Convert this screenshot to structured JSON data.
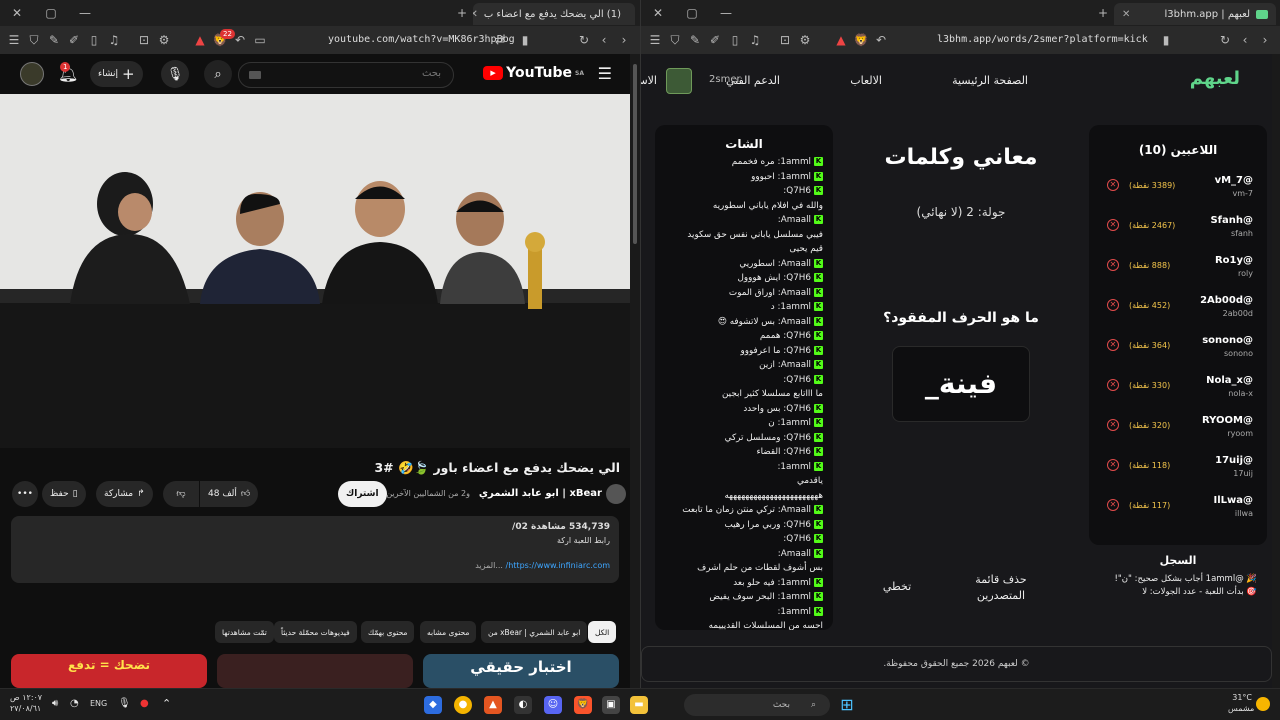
{
  "left": {
    "tab_title": "(1) الي يضحك يدفع مع اعضاء ب",
    "url": "youtube.com/watch?v=MK86r3hpBbg",
    "brave_count": "22",
    "yt": {
      "logo": "YouTube",
      "region": "SA",
      "search_placeholder": "بحث",
      "create_label": "إنشاء",
      "notif_count": "1"
    },
    "video_title": "الي يضحك يدفع مع اعضاء باور 🍃🤣 #3",
    "channel": "xBear | ابو عابد الشمري",
    "collab": "و2 من الشماليين الآخرين",
    "subscribe": "اشتراك",
    "likes": "48 ألف",
    "share": "مشاركة",
    "save": "حفظ",
    "views": "534,739 مشاهدة 02/",
    "desc_line": "رابط اللعبة اركة",
    "desc_link": "https://www.infiniarc.com/",
    "more": "...المزيد",
    "chips": [
      "الكل",
      "من xBear | ابو عابد الشمري",
      "محتوى مشابه",
      "محتوى بهمّك",
      "فيديوهات محمّلة حديثاً",
      "تمّت مشاهدتها"
    ],
    "thumb_texts": [
      "تضحك = تدفع",
      "",
      "اختبار حقيقي"
    ]
  },
  "right": {
    "tab_title": "لعبهم | l3bhm.app",
    "url": "l3bhm.app/words/2smer?platform=kick",
    "logo": "لعبهم",
    "nav": [
      "الصفحة الرئيسية",
      "الالعاب",
      "الدعم الفني"
    ],
    "nav_user": "2smer",
    "nav_partial": "الاس",
    "players_title": "اللاعبين (10)",
    "players": [
      {
        "name": "@vM_7",
        "id": "vm-7",
        "points": "(3389 نقطة)"
      },
      {
        "name": "@Sfanh",
        "id": "sfanh",
        "points": "(2467 نقطة)"
      },
      {
        "name": "@Ro1y",
        "id": "roly",
        "points": "(888 نقطة)"
      },
      {
        "name": "@2Ab00d",
        "id": "2ab00d",
        "points": "(452 نقطة)"
      },
      {
        "name": "@sonono",
        "id": "sonono",
        "points": "(364 نقطة)"
      },
      {
        "name": "@Nola_x",
        "id": "nola-x",
        "points": "(330 نقطة)"
      },
      {
        "name": "@RYOOM",
        "id": "ryoom",
        "points": "(320 نقطة)"
      },
      {
        "name": "@17uij",
        "id": "17uij",
        "points": "(118 نقطة)"
      },
      {
        "name": "@IlLwa",
        "id": "illwa",
        "points": "(117 نقطة)"
      }
    ],
    "log_title": "السجل",
    "log": [
      "🎉 @1amml أجاب بشكل صحيح: \"ن\"!",
      "🎯 بدأت اللعبة - عدد الجولات: لا"
    ],
    "game_title": "معاني وكلمات",
    "round": "جولة: 2 (لا نهائي)",
    "question": "ما هو الحرف المفقود؟",
    "word": "فينة_",
    "btn_clear": "حذف قائمة المتصدرين",
    "btn_skip": "تخطي",
    "chat_title": "الشات",
    "chat": [
      {
        "u": "1amml:",
        "m": "مره فخممم",
        "k": true
      },
      {
        "u": "1amml:",
        "m": "احبووو",
        "k": true
      },
      {
        "u": "Q7H6:",
        "m": "",
        "k": true
      },
      {
        "u": "",
        "m": "والله في افلام ياباني اسطوريه",
        "k": false
      },
      {
        "u": "Amaall:",
        "m": "",
        "k": true
      },
      {
        "u": "",
        "m": "فيبي مسلسل ياباني نفس حق سكويد",
        "k": false
      },
      {
        "u": "",
        "m": "قيم يحيى",
        "k": false
      },
      {
        "u": "Amaall:",
        "m": "اسطوريي",
        "k": true
      },
      {
        "u": "Q7H6:",
        "m": "ايش هووول",
        "k": true
      },
      {
        "u": "Amaall:",
        "m": "اوراق الموت",
        "k": true
      },
      {
        "u": "1amml:",
        "m": "د",
        "k": true
      },
      {
        "u": "Amaall:",
        "m": "بس لاتشوفه 😍",
        "k": true
      },
      {
        "u": "Q7H6:",
        "m": "هممم",
        "k": true
      },
      {
        "u": "Q7H6:",
        "m": "ما اعرفووو",
        "k": true
      },
      {
        "u": "Amaall:",
        "m": "ازين",
        "k": true
      },
      {
        "u": "Q7H6:",
        "m": "",
        "k": true
      },
      {
        "u": "",
        "m": "ما اااتابع مسلسلا كثير ابجين",
        "k": false
      },
      {
        "u": "Q7H6:",
        "m": "بس واحدد",
        "k": true
      },
      {
        "u": "1amml:",
        "m": "ن",
        "k": true
      },
      {
        "u": "Q7H6:",
        "m": "ومسلسل تركي",
        "k": true
      },
      {
        "u": "Q7H6:",
        "m": "القضاء",
        "k": true
      },
      {
        "u": "1amml:",
        "m": "",
        "k": true
      },
      {
        "u": "",
        "m": "ياقدمي",
        "k": false
      },
      {
        "u": "",
        "m": "هههههههههههههههههههههههه",
        "k": false
      },
      {
        "u": "Amaall:",
        "m": "تركي منتن زمان ما تابعت",
        "k": true
      },
      {
        "u": "Q7H6:",
        "m": "وربي مرا رهيب",
        "k": true
      },
      {
        "u": "Q7H6:",
        "m": "",
        "k": true
      },
      {
        "u": "Amaall:",
        "m": "",
        "k": true
      },
      {
        "u": "",
        "m": "بس أشوف لقطات من حلم اشرف",
        "k": false
      },
      {
        "u": "1amml:",
        "m": "فيه حلو بعد",
        "k": true
      },
      {
        "u": "1amml:",
        "m": "البحر سوف يفيض",
        "k": true
      },
      {
        "u": "1amml:",
        "m": "",
        "k": true
      },
      {
        "u": "",
        "m": "احسه من المسلسلات القديييمه",
        "k": false
      }
    ],
    "footer": "© لعبهم 2026 جميع الحقوق محفوظة."
  },
  "taskbar": {
    "time": "١٢:٠٧ ص",
    "date": "٢٧/٠٨/٦١",
    "lang": "ENG",
    "search": "بحث",
    "temp": "31°C",
    "weather": "مشمس"
  }
}
